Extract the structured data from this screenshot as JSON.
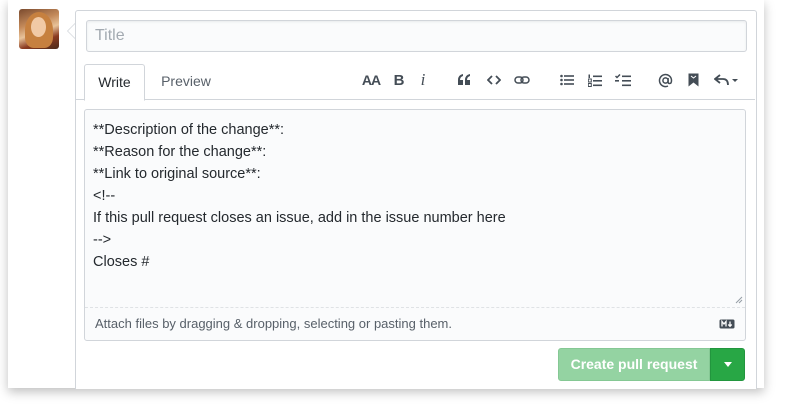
{
  "title_field": {
    "placeholder": "Title",
    "value": ""
  },
  "tabs": [
    {
      "label": "Write",
      "active": true
    },
    {
      "label": "Preview",
      "active": false
    }
  ],
  "toolbar": {
    "heading_label": "AA",
    "bold_label": "B",
    "italic_label": "i",
    "icons": [
      "heading-icon",
      "bold-icon",
      "italic-icon",
      "quote-icon",
      "code-icon",
      "link-icon",
      "bullet-list-icon",
      "numbered-list-icon",
      "task-list-icon",
      "mention-icon",
      "bookmark-icon",
      "reply-icon"
    ]
  },
  "body": {
    "lines": [
      "**Description of the change**:",
      "**Reason for the change**:",
      "**Link to original source**:",
      "<!--",
      "If this pull request closes an issue, add in the issue number here",
      "-->",
      "Closes #"
    ]
  },
  "attach": {
    "text": "Attach files by dragging & dropping, selecting or pasting them."
  },
  "actions": {
    "create_label": "Create pull request"
  },
  "colors": {
    "primary_green": "#28a745",
    "disabled_green": "#94d3a2",
    "border": "#d1d5da"
  }
}
